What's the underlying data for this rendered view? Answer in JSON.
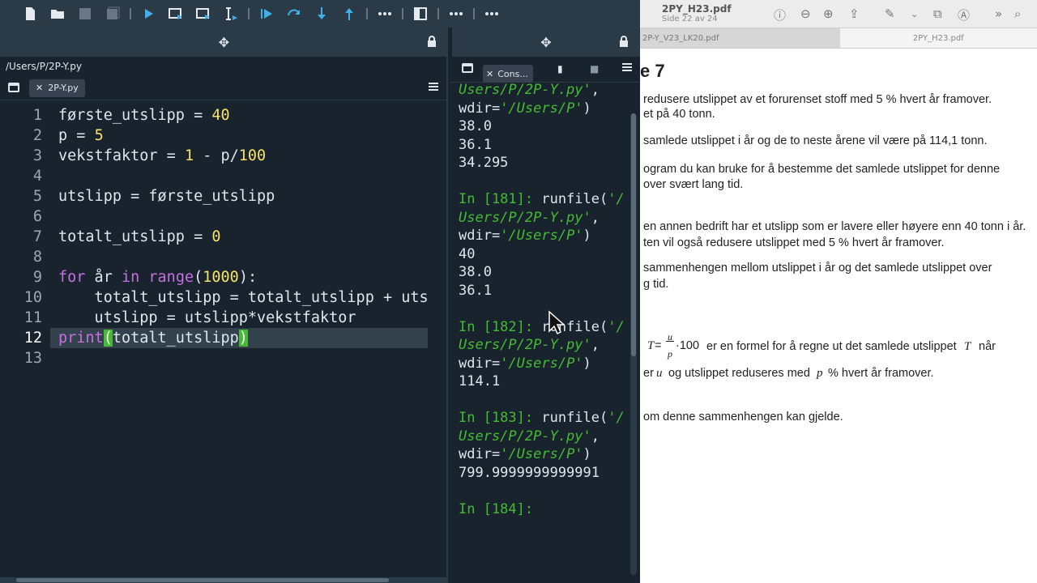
{
  "toolbar": {
    "icons": [
      "new-file-icon",
      "open-folder-icon",
      "save-icon",
      "save-all-icon",
      "run-icon",
      "run-cell-icon",
      "run-cell-advance-icon",
      "run-selection-icon",
      "debug-icon",
      "step-icon",
      "step-into-icon",
      "step-return-icon",
      "more-icon",
      "maximize-pane-icon",
      "more-icon-2",
      "more-icon-3"
    ]
  },
  "editor": {
    "path": "/Users/P/2P-Y.py",
    "tab_label": "2P-Y.py",
    "current_line": "12",
    "line_numbers": [
      "1",
      "2",
      "3",
      "4",
      "5",
      "6",
      "7",
      "8",
      "9",
      "10",
      "11",
      "12",
      "13"
    ],
    "lines": {
      "l1": {
        "a": "første_utslipp = ",
        "b": "40"
      },
      "l2": {
        "a": "p = ",
        "b": "5"
      },
      "l3": {
        "a": "vekstfaktor = ",
        "b": "1",
        "c": " - p/",
        "d": "100"
      },
      "l5": {
        "a": "utslipp = første_utslipp"
      },
      "l7": {
        "a": "totalt_utslipp = ",
        "b": "0"
      },
      "l9": {
        "a": "for",
        "b": " år ",
        "c": "in",
        "d": " ",
        "e": "range",
        "f": "(",
        "g": "1000",
        "h": "):"
      },
      "l10": {
        "a": "    totalt_utslipp = totalt_utslipp + utslipp"
      },
      "l11": {
        "a": "    utslipp = utslipp*vekstfaktor"
      },
      "l12": {
        "a": "print",
        "b": "(",
        "c": "totalt_utslipp",
        "d": ")"
      }
    }
  },
  "console": {
    "tab_label": "Cons...",
    "top": {
      "a": "Users/P/2P-Y.py'",
      "b": ",",
      "c": "wdir=",
      "d": "'/Users/P'",
      "e": ")"
    },
    "out1": [
      "38.0",
      "36.1",
      "34.295"
    ],
    "p181": {
      "prompt": "In [181]:",
      "cmd": " runfile(",
      "s1": "'/",
      "s2": "Users/P/2P-Y.py'",
      "comma": ",",
      "wdir": "wdir=",
      "s3": "'/Users/P'",
      "close": ")"
    },
    "out2": [
      "40",
      "38.0",
      "36.1"
    ],
    "p182": {
      "prompt": "In [182]:",
      "cmd": " runfile(",
      "s1": "'/",
      "s2": "Users/P/2P-Y.py'",
      "comma": ",",
      "wdir": "wdir=",
      "s3": "'/Users/P'",
      "close": ")"
    },
    "out3": "114.1",
    "p183": {
      "prompt": "In [183]:",
      "cmd": " runfile(",
      "s1": "'/",
      "s2": "Users/P/2P-Y.py'",
      "comma": ",",
      "wdir": "wdir=",
      "s3": "'/Users/P'",
      "close": ")"
    },
    "out4": "799.9999999999991",
    "p184": "In [184]:"
  },
  "pdf": {
    "title": "2PY_H23.pdf",
    "subtitle": "Side 22 av 24",
    "tab1": "2P-Y_V23_LK20.pdf",
    "tab2": "2PY_H23.pdf",
    "heading": "e 7",
    "t1": "redusere utslippet av et forurenset stoff med 5 % hvert år framover.",
    "t2": "et på 40 tonn.",
    "t3": "samlede utslippet i år og de to neste årene vil være på 114,1 tonn.",
    "t4": "ogram du kan bruke for å bestemme det samlede utslippet for denne",
    "t5": "over svært lang tid.",
    "t6": "en annen bedrift har et utslipp som er lavere eller høyere enn 40 tonn i år.",
    "t7": "ten vil også redusere utslippet med 5 % hvert år framover.",
    "t8": "sammenhengen mellom utslippet i år og det samlede utslippet over",
    "t9": "g tid.",
    "f_T": "T",
    "f_eq": " = ",
    "f_u": "u",
    "f_p": "p",
    "f_rest": "·100",
    "t10": "er en formel for å regne ut det samlede utslippet",
    "t10T": "T",
    "t10b": "når",
    "t11a": "er",
    "t11u": "u",
    "t11b": "og utslippet reduseres med",
    "t11p": "p",
    "t11c": "% hvert år framover.",
    "t12": "om denne sammenhengen kan gjelde."
  }
}
